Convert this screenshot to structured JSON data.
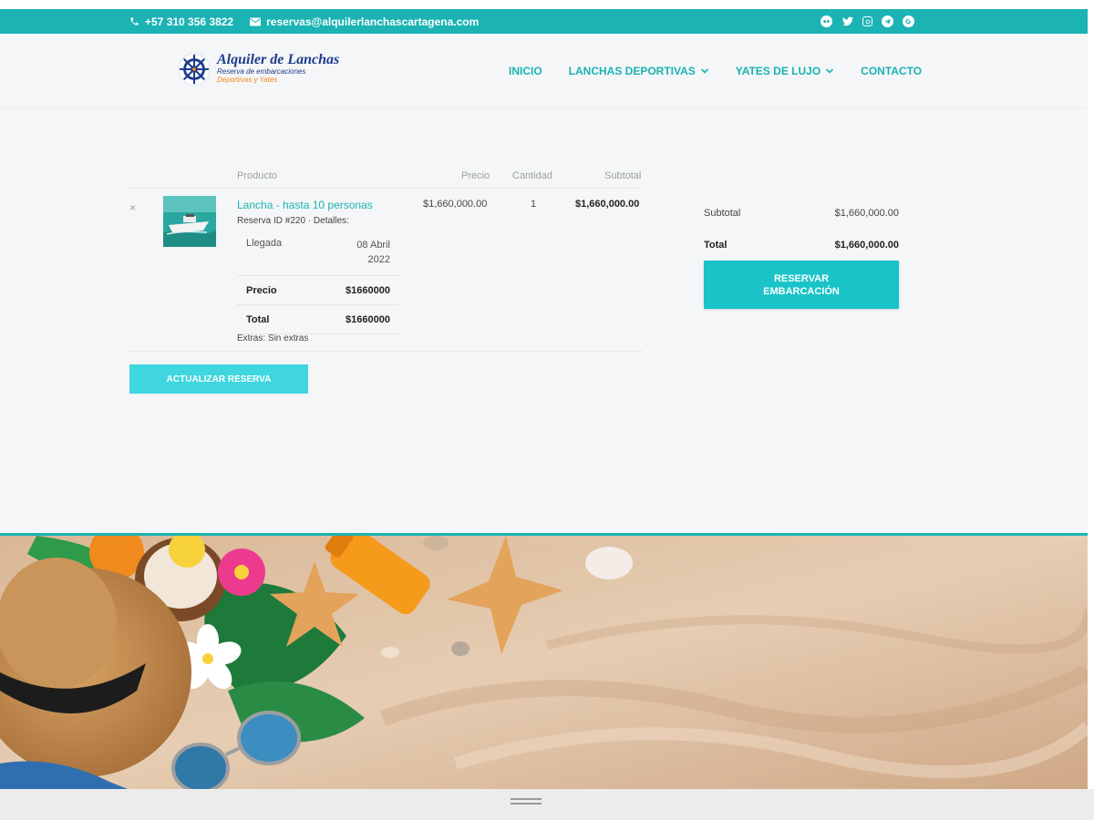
{
  "topbar": {
    "phone": "+57 310 356 3822",
    "email": "reservas@alquilerlanchascartagena.com",
    "social": [
      "tripadvisor-icon",
      "twitter-icon",
      "instagram-icon",
      "telegram-icon",
      "google-icon"
    ]
  },
  "logo": {
    "title": "Alquiler de Lanchas",
    "subtitle1": "Reserva de embarcaciones",
    "subtitle2": "Deportivas y Yates"
  },
  "nav": {
    "items": [
      {
        "label": "INICIO",
        "dropdown": false
      },
      {
        "label": "LANCHAS DEPORTIVAS",
        "dropdown": true
      },
      {
        "label": "YATES DE LUJO",
        "dropdown": true
      },
      {
        "label": "CONTACTO",
        "dropdown": false
      }
    ]
  },
  "cart": {
    "headers": {
      "product": "Producto",
      "price": "Precio",
      "quantity": "Cantidad",
      "subtotal": "Subtotal"
    },
    "item": {
      "remove": "×",
      "name": "Lancha - hasta 10 personas",
      "meta": "Reserva ID #220 · Detalles:",
      "details": [
        {
          "label": "Llegada",
          "value": "08 Abril 2022",
          "bold": false
        },
        {
          "label": "Precio",
          "value": "$1660000",
          "bold": true
        },
        {
          "label": "Total",
          "value": "$1660000",
          "bold": true
        }
      ],
      "extras": "Extras: Sin extras",
      "price": "$1,660,000.00",
      "quantity": "1",
      "subtotal": "$1,660,000.00"
    },
    "update_button": "ACTUALIZAR RESERVA"
  },
  "totals": {
    "subtotal_label": "Subtotal",
    "subtotal_value": "$1,660,000.00",
    "total_label": "Total",
    "total_value": "$1,660,000.00",
    "book_button": "RESERVAR EMBARCACIÓN"
  },
  "colors": {
    "accent": "#1bb3b3",
    "button": "#19c3c8",
    "button_light": "#3fd6df",
    "logo_blue": "#1b3b8c",
    "logo_orange": "#f08a1c"
  }
}
